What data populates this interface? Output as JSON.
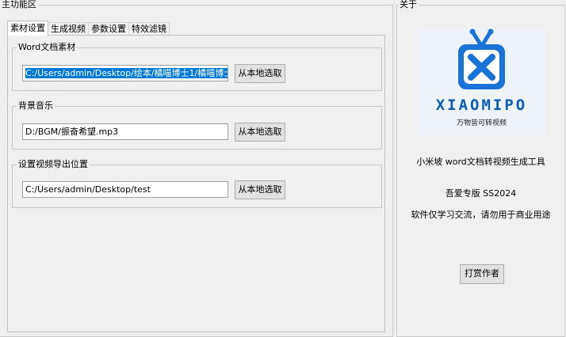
{
  "main": {
    "group_title": "主功能区",
    "tabs": [
      {
        "label": "素材设置",
        "active": true
      },
      {
        "label": "生成视频",
        "active": false
      },
      {
        "label": "参数设置",
        "active": false
      },
      {
        "label": "特效滤镜",
        "active": false
      }
    ],
    "word": {
      "title": "Word文档素材",
      "path": "C:/Users/admin/Desktop/绘本/橘喵博士1/橘喵博士",
      "button": "从本地选取"
    },
    "music": {
      "title": "背景音乐",
      "path": "D:/BGM/振奋希望.mp3",
      "button": "从本地选取"
    },
    "export": {
      "title": "设置视频导出位置",
      "path": "C:/Users/admin/Desktop/test",
      "button": "从本地选取"
    }
  },
  "about": {
    "group_title": "关于",
    "logo_name": "XIAOMIPO",
    "logo_slogan": "万物皆可转视频",
    "product": "小米坡 word文档转视频生成工具",
    "edition": "吾爱专版 SS2024",
    "notice": "软件仅学习交流，请勿用于商业用途",
    "tip_button": "打赏作者"
  },
  "colors": {
    "accent": "#0078d7",
    "logo_blue": "#1a73d9"
  }
}
